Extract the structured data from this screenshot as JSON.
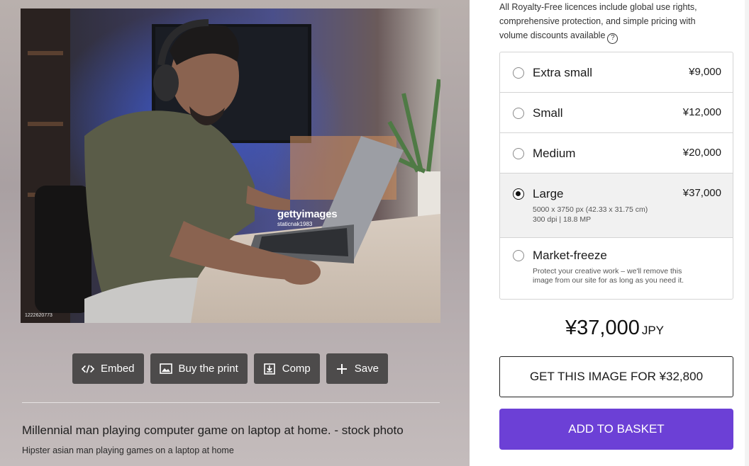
{
  "photo": {
    "watermark_brand": "gettyimages",
    "watermark_credit": "staticnak1983",
    "image_id": "1222620773"
  },
  "actions": [
    {
      "label": "Embed",
      "icon": "code-icon"
    },
    {
      "label": "Buy the print",
      "icon": "image-icon"
    },
    {
      "label": "Comp",
      "icon": "download-icon"
    },
    {
      "label": "Save",
      "icon": "plus-icon"
    }
  ],
  "title": "Millennial man playing computer game on laptop at home. - stock photo",
  "description": "Hipster asian man playing games on a laptop at home",
  "licence_note": "All Royalty-Free licences include global use rights, comprehensive protection, and simple pricing with volume discounts available",
  "sizes": [
    {
      "name": "Extra small",
      "price": "¥9,000",
      "selected": false
    },
    {
      "name": "Small",
      "price": "¥12,000",
      "selected": false
    },
    {
      "name": "Medium",
      "price": "¥20,000",
      "selected": false
    },
    {
      "name": "Large",
      "price": "¥37,000",
      "selected": true,
      "detail_1": "5000 x 3750 px (42.33 x 31.75 cm)",
      "detail_2": "300 dpi | 18.8 MP"
    },
    {
      "name": "Market-freeze",
      "price": "",
      "selected": false,
      "detail_1": "Protect your creative work – we'll remove this",
      "detail_2": "image from our site for as long as you need it."
    }
  ],
  "total": {
    "amount": "¥37,000",
    "currency": "JPY"
  },
  "buttons": {
    "get_image": "GET THIS IMAGE FOR ¥32,800",
    "add_to_basket": "ADD TO BASKET"
  },
  "colors": {
    "accent": "#6c40d6",
    "action_button": "#4d4b4b"
  }
}
